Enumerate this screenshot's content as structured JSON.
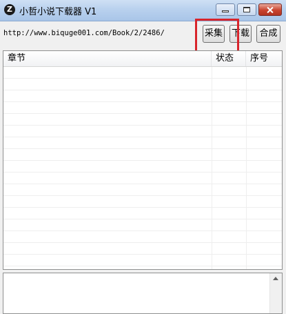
{
  "window": {
    "title": "小哲小说下载器 V1",
    "icon_letter": "Z"
  },
  "toolbar": {
    "url_value": "http://www.biquge001.com/Book/2/2486/",
    "collect_label": "采集",
    "download_label": "下载",
    "merge_label": "合成"
  },
  "list": {
    "columns": [
      "章节",
      "状态",
      "序号"
    ],
    "rows": []
  },
  "log": {
    "text": ""
  },
  "colors": {
    "highlight": "#d8242b",
    "titlebar": "#b9d1ee"
  }
}
